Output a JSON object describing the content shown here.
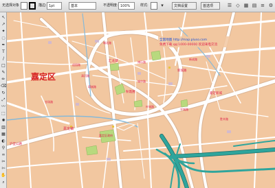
{
  "toolbar": {
    "items": [
      "无选择对象",
      "描边:",
      "基本",
      "不透明度:",
      "100%",
      "样式:",
      "文档设置",
      "首选项"
    ],
    "stroke_weight": "1pt",
    "colors": {
      "fill": "#ffffff",
      "stroke": "#000000"
    }
  },
  "tools": [
    "selection-tool",
    "direct-selection-tool",
    "magic-wand-tool",
    "lasso-tool",
    "pen-tool",
    "type-tool",
    "line-tool",
    "rectangle-tool",
    "paintbrush-tool",
    "pencil-tool",
    "eraser-tool",
    "rotate-tool",
    "scale-tool",
    "warp-tool",
    "free-transform-tool",
    "symbol-sprayer-tool",
    "graph-tool",
    "mesh-tool",
    "gradient-tool",
    "eyedropper-tool",
    "blend-tool",
    "slice-tool",
    "scissors-tool",
    "hand-tool",
    "zoom-tool"
  ],
  "map": {
    "district_label": "嘉定区",
    "notice_lines": [
      "全国地图 http://map.pluso.com",
      "免费下载 qq:1000-00000 欢迎来电交流"
    ],
    "place_labels": [
      "嘉定镇",
      "新城路",
      "嘉定新城",
      "汇龙潭",
      "秋霞圃",
      "嘉定区政府",
      "博乐路",
      "清河路",
      "城中路",
      "沪宜公路",
      "塔城路",
      "叶城路",
      "城北路",
      "平城路",
      "仓场路",
      "胜辛路",
      "新成路",
      "迎园路"
    ],
    "colors": {
      "land": "#f2c7a0",
      "road": "#ffffff",
      "road_casing": "#d9b394",
      "park": "#b8d97e",
      "water": "#86b9d8",
      "expressway": "#2fa59c",
      "label": "#e0224a",
      "district_label": "#d62020",
      "notice": "#1a4fd8"
    }
  }
}
